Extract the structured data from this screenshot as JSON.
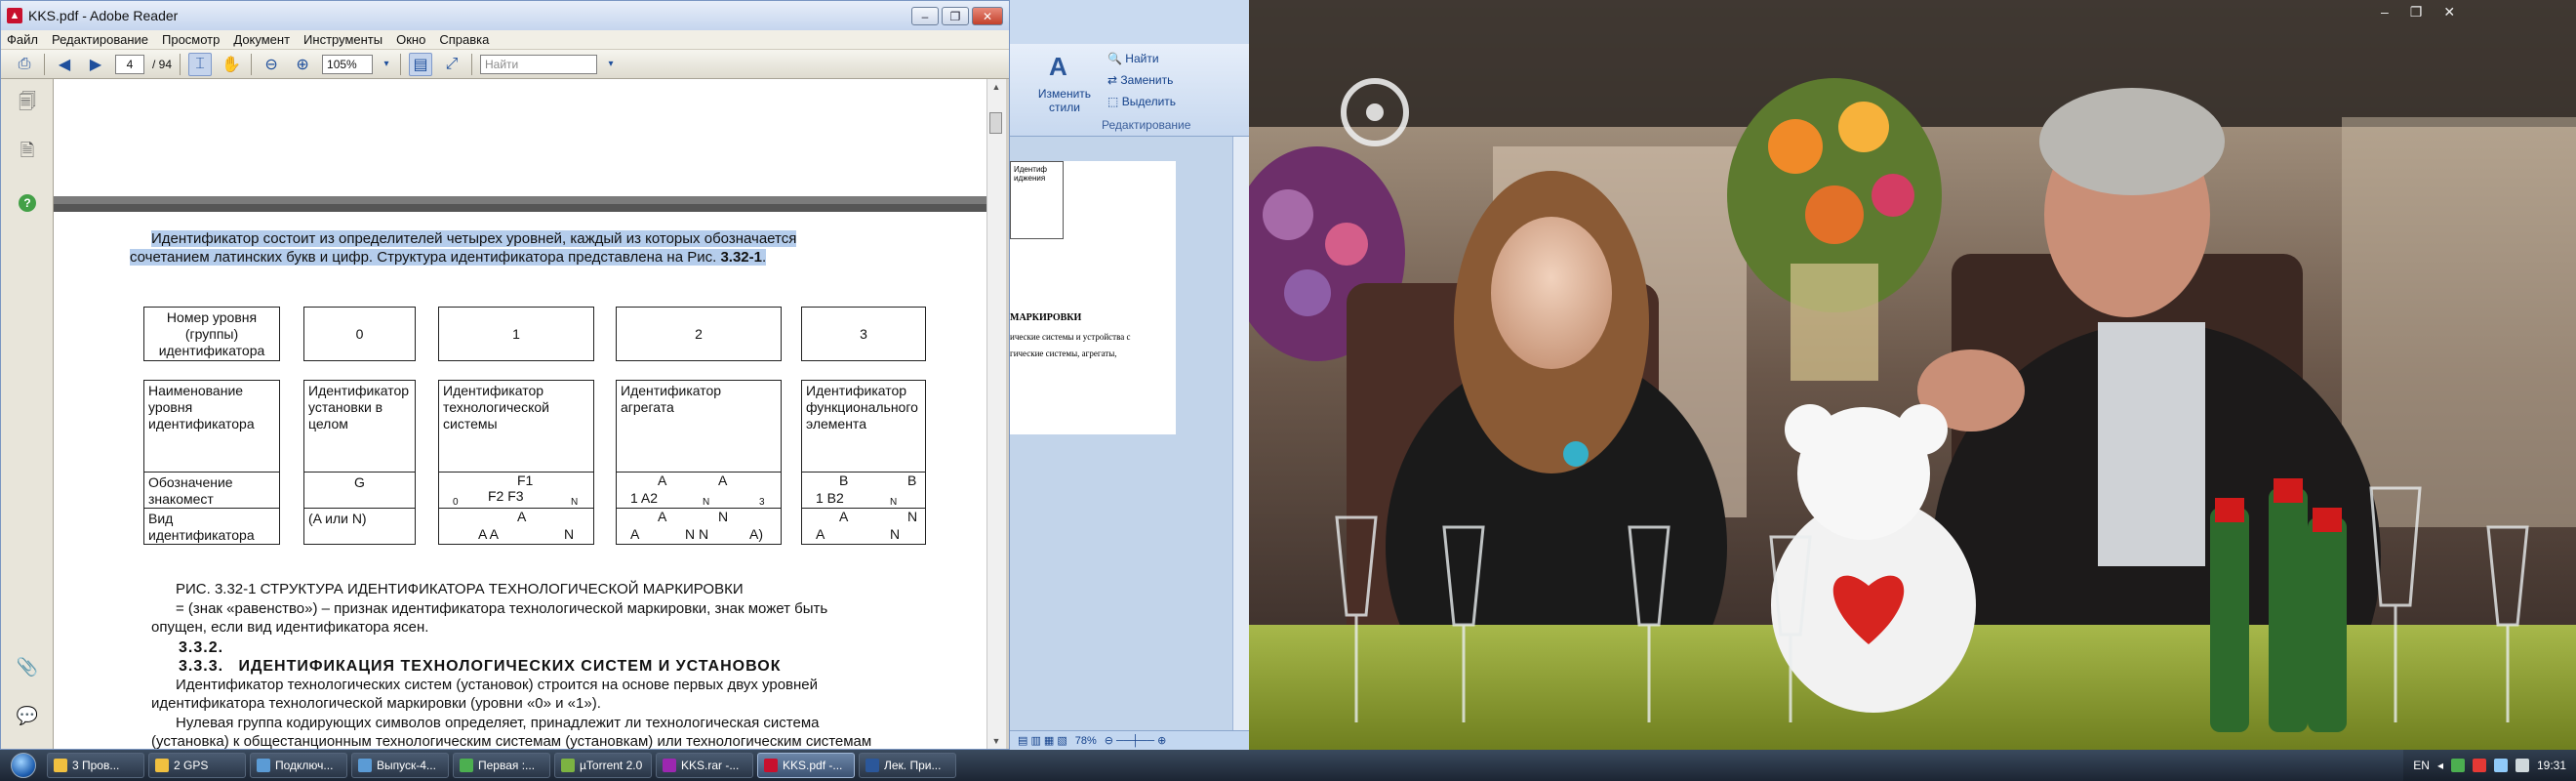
{
  "reader": {
    "title": "KKS.pdf - Adobe Reader",
    "menu": [
      "Файл",
      "Редактирование",
      "Просмотр",
      "Документ",
      "Инструменты",
      "Окно",
      "Справка"
    ],
    "page_current": "4",
    "page_total": "/ 94",
    "zoom": "105%",
    "find_placeholder": "Найти"
  },
  "doc": {
    "intro_line1": "Идентификатор состоит из определителей четырех уровней, каждый из которых обозначается",
    "intro_line2": "сочетанием латинских букв и цифр. Структура идентификатора представлена на Рис. ",
    "intro_ref": "3.32-1",
    "row1": {
      "label": "Номер уровня (группы) идентификатора",
      "c0": "0",
      "c1": "1",
      "c2": "2",
      "c3": "3"
    },
    "row2": {
      "label": "Наименование уровня идентификатора",
      "c0": "Идентификатор установки в целом",
      "c1": "Идентификатор технологической системы",
      "c2": "Идентификатор агрегата",
      "c3": "Идентификатор функционального элемента"
    },
    "row3": {
      "label": "Обозначение знакомест",
      "c0": "G",
      "c1_top": "F1",
      "c1_mid": "F2 F3",
      "c1_a": "0",
      "c1_b": "N",
      "c2_a": "A",
      "c2_b": "A",
      "c2_sub": "1 A2",
      "c2_n": "N",
      "c2_3": "3",
      "c3_a": "B",
      "c3_b": "B",
      "c3_sub": "1 B2",
      "c3_n": "N"
    },
    "row4": {
      "label": "Вид идентификатора",
      "c0": "(A или N)",
      "c1_a": "A",
      "c1_b": "A  A",
      "c1_n": "N",
      "c2_a": "A",
      "c2_b": "N N",
      "c2_c": "A)",
      "c2_n": "N",
      "c3_a": "A",
      "c3_b": "N",
      "c3_c": "N"
    },
    "caption": "РИС. 3.32-1 СТРУКТУРА ИДЕНТИФИКАТОРА ТЕХНОЛОГИЧЕСКОЙ МАРКИРОВКИ",
    "para_equal_1": "= (знак «равенство») – признак идентификатора технологической маркировки, знак может быть",
    "para_equal_2": "опущен, если вид идентификатора ясен.",
    "h_332": "3.3.2.",
    "h_333_num": "3.3.3.",
    "h_333_text": "ИДЕНТИФИКАЦИЯ ТЕХНОЛОГИЧЕСКИХ СИСТЕМ И УСТАНОВОК",
    "para_sys_1": "Идентификатор технологических систем (установок) строится на основе первых двух уровней",
    "para_sys_2": "идентификатора технологической маркировки (уровни «0» и «1»).",
    "para_null_1": "Нулевая группа кодирующих символов определяет, принадлежит ли технологическая система",
    "para_null_2": "(установка) к общестанционным технологическим системам (установкам) или технологическим системам"
  },
  "word": {
    "find": "Найти",
    "replace": "Заменить",
    "select": "Выделить",
    "change_styles": "Изменить стили",
    "group_label": "Редактирование",
    "doc_heading": "МАРКИРОВКИ",
    "doc_line1": "ические системы и устройства с",
    "doc_line2": "гические системы, агрегаты,",
    "doc_cell": "Идентиф",
    "doc_cell2": "иджения",
    "zoom": "78%"
  },
  "taskbar": {
    "tasks": [
      {
        "label": "3 Пров...",
        "color": "#f0c040"
      },
      {
        "label": "2 GPS",
        "color": "#f0c040"
      },
      {
        "label": "Подключ...",
        "color": "#5b9bd5"
      },
      {
        "label": "Выпуск-4...",
        "color": "#5b9bd5"
      },
      {
        "label": "Первая :...",
        "color": "#4caf50"
      },
      {
        "label": "µTorrent 2.0",
        "color": "#7cb342"
      },
      {
        "label": "KKS.rar -...",
        "color": "#9c27b0"
      },
      {
        "label": "KKS.pdf -...",
        "color": "#c8102e"
      },
      {
        "label": "Лек. При...",
        "color": "#2b579a"
      }
    ],
    "lang": "EN",
    "clock": "19:31"
  },
  "colors": {
    "highlight": "#b5cdec",
    "reader_red": "#c8102e",
    "taskbar": "#1c2533"
  }
}
